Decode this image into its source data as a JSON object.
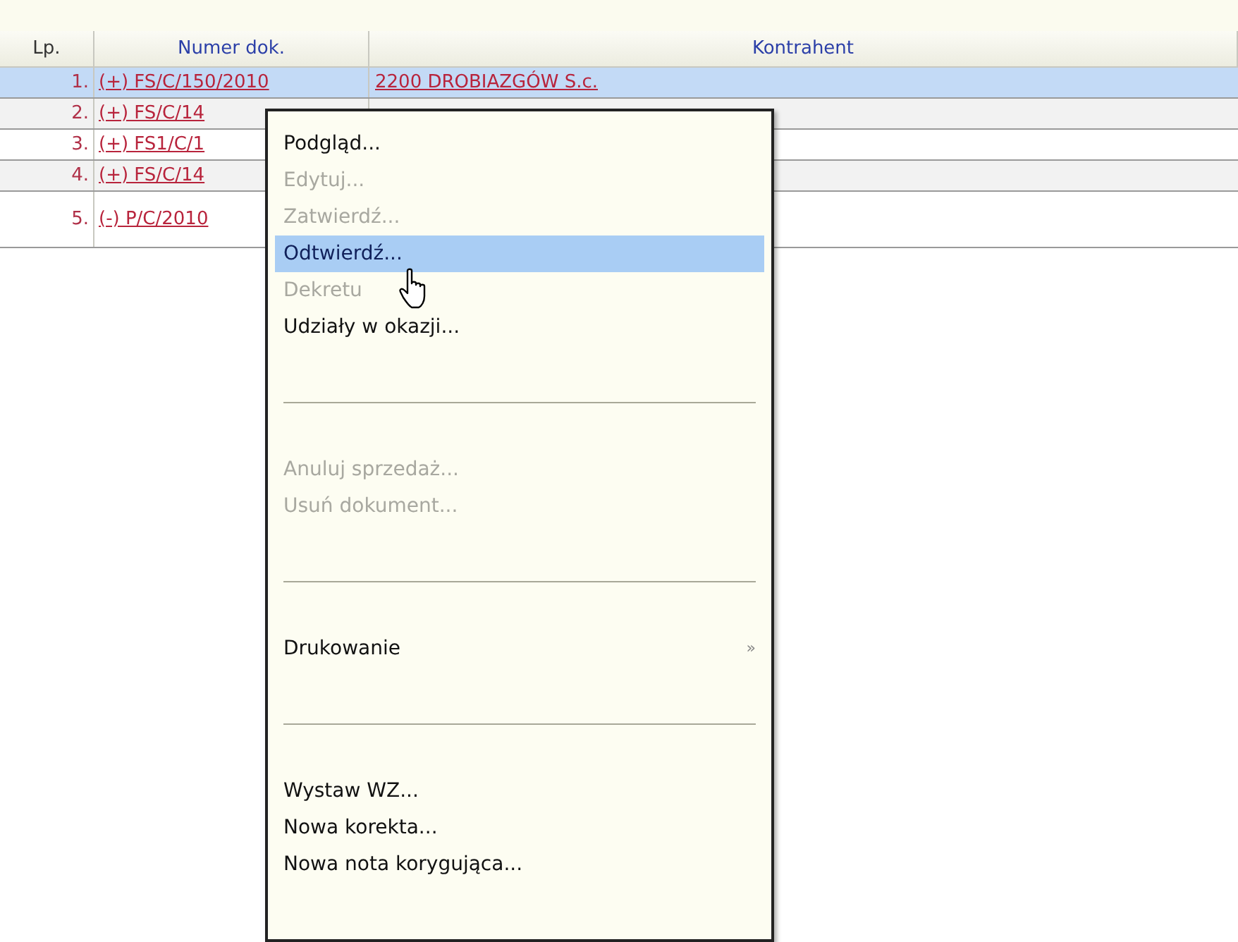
{
  "table": {
    "columns": [
      {
        "label": "Lp."
      },
      {
        "label": "Numer dok."
      },
      {
        "label": "Kontrahent"
      }
    ],
    "rows": [
      {
        "lp": "1.",
        "number": "(+) FS/C/150/2010",
        "contractor": "2200 DROBIAZGÓW S.c.",
        "selected": true,
        "tall": false
      },
      {
        "lp": "2.",
        "number": "(+) FS/C/14",
        "selected": false,
        "tall": false
      },
      {
        "lp": "3.",
        "number": "(+) FS1/C/1",
        "selected": false,
        "tall": false
      },
      {
        "lp": "4.",
        "number": "(+) FS/C/14",
        "selected": false,
        "tall": false
      },
      {
        "lp": "5.",
        "number": "(-) P/C/2010",
        "selected": false,
        "tall": true
      }
    ]
  },
  "context_menu": {
    "items": [
      {
        "kind": "item",
        "label": "Podgląd...",
        "disabled": false,
        "selected": false
      },
      {
        "kind": "item",
        "label": "Edytuj...",
        "disabled": true,
        "selected": false
      },
      {
        "kind": "item",
        "label": "Zatwierdź...",
        "disabled": true,
        "selected": false
      },
      {
        "kind": "item",
        "label": "Odtwierdź...",
        "disabled": false,
        "selected": true
      },
      {
        "kind": "item",
        "label": "Dekretu",
        "disabled": true,
        "selected": false
      },
      {
        "kind": "item",
        "label": "Udziały w okazji...",
        "disabled": false,
        "selected": false
      },
      {
        "kind": "separator"
      },
      {
        "kind": "item",
        "label": "Anuluj sprzedaż...",
        "disabled": true,
        "selected": false
      },
      {
        "kind": "item",
        "label": "Usuń dokument...",
        "disabled": true,
        "selected": false
      },
      {
        "kind": "separator"
      },
      {
        "kind": "submenu",
        "label": "Drukowanie",
        "arrow": "»",
        "disabled": false,
        "selected": false
      },
      {
        "kind": "separator"
      },
      {
        "kind": "item",
        "label": "Wystaw WZ...",
        "disabled": false,
        "selected": false
      },
      {
        "kind": "item",
        "label": "Nowa korekta...",
        "disabled": false,
        "selected": false
      },
      {
        "kind": "item",
        "label": "Nowa nota korygująca...",
        "disabled": false,
        "selected": false
      }
    ]
  }
}
